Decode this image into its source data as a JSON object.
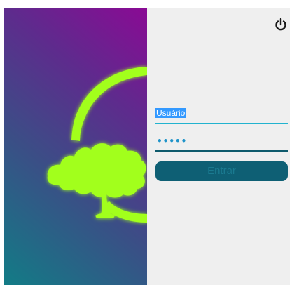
{
  "login": {
    "username_value": "Usuário",
    "password_value": "•••••",
    "submit_label": "Entrar"
  },
  "icons": {
    "power": "power-icon",
    "logo": "tree-logo-icon"
  },
  "colors": {
    "gradient_start": "#127c86",
    "gradient_end": "#8a0a94",
    "logo_green": "#a2ff1a",
    "username_underline": "#22b3cf",
    "password_underline": "#0e5a6c",
    "button_bg": "#0e5f74",
    "panel_bg": "#efefef"
  }
}
